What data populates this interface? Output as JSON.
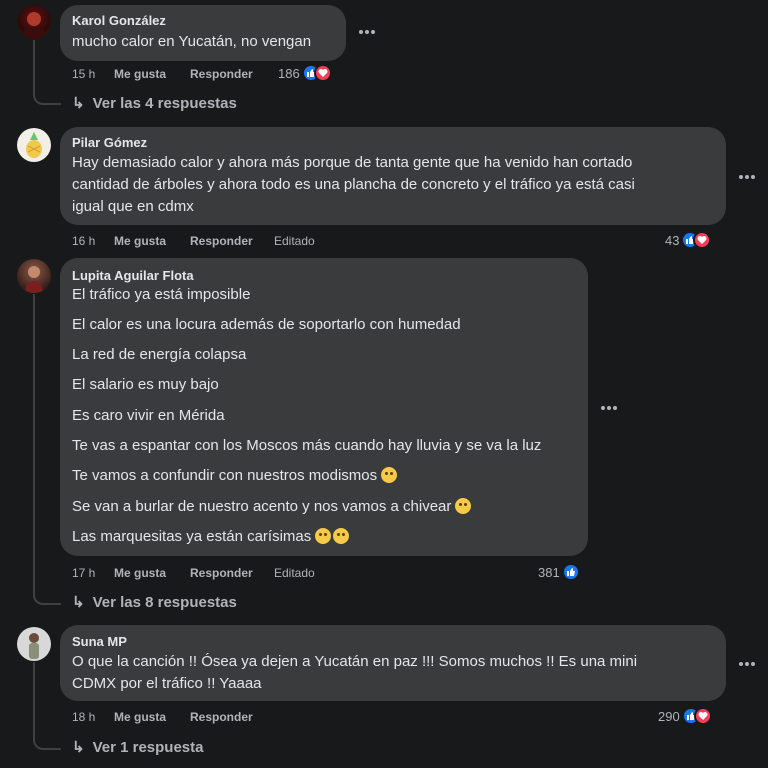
{
  "comments": [
    {
      "author": "Karol González",
      "lines": [
        "mucho calor en Yucatán, no vengan"
      ],
      "time": "15 h",
      "like_label": "Me gusta",
      "reply_label": "Responder",
      "reaction_count": "186",
      "replies_label": "Ver las 4 respuestas"
    },
    {
      "author": "Pilar Gómez",
      "lines": [
        "Hay demasiado calor y ahora más porque de tanta gente que ha venido han cortado",
        "cantidad de árboles y ahora todo es una plancha de concreto y el tráfico ya está casi",
        "igual que en cdmx"
      ],
      "time": "16 h",
      "like_label": "Me gusta",
      "reply_label": "Responder",
      "edited_label": "Editado",
      "reaction_count": "43"
    },
    {
      "author": "Lupita Aguilar Flota",
      "lines": [
        "El tráfico ya está imposible",
        "El calor es una locura además de soportarlo con humedad",
        "La red de energía colapsa",
        "El salario es muy bajo",
        "Es caro vivir en Mérida",
        "Te vas a espantar con los Moscos más cuando hay lluvia y se va la luz",
        "Te vamos a confundir con nuestros modismos",
        "Se van a burlar de nuestro acento y nos vamos a chivear",
        "Las marquesitas ya están carísimas"
      ],
      "time": "17 h",
      "like_label": "Me gusta",
      "reply_label": "Responder",
      "edited_label": "Editado",
      "reaction_count": "381",
      "replies_label": "Ver las 8 respuestas"
    },
    {
      "author": "Suna MP",
      "lines": [
        "O que la canción !! Ósea ya dejen a Yucatán en paz !!! Somos muchos !! Es una mini",
        "CDMX por el tráfico !! Yaaaa"
      ],
      "time": "18 h",
      "like_label": "Me gusta",
      "reply_label": "Responder",
      "reaction_count": "290",
      "replies_label": "Ver 1 respuesta"
    }
  ],
  "colors": {
    "background": "#18191a",
    "bubble": "#3a3b3c",
    "text": "#e4e6eb",
    "secondary": "#b0b3b8",
    "like": "#1877f2",
    "love": "#f33e58"
  }
}
